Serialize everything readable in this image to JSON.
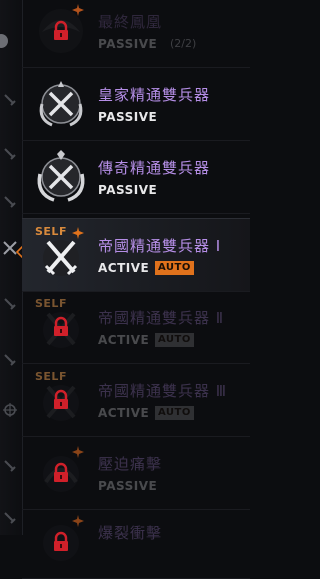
{
  "skills": [
    {
      "title": "最終鳳凰",
      "type": "PASSIVE",
      "locked": true,
      "emblem": "lock-icon"
    },
    {
      "title": "皇家精通雙兵器",
      "type": "PASSIVE",
      "locked": false,
      "emblem": "crossed-blades-emblem"
    },
    {
      "title": "傳奇精通雙兵器",
      "type": "PASSIVE",
      "locked": false,
      "emblem": "crossed-blades-emblem"
    },
    {
      "title": "帝國精通雙兵器 Ⅰ",
      "type": "ACTIVE",
      "auto": "AUTO",
      "self": "SELF",
      "selected": true,
      "emblem": "crossed-swords-emblem"
    },
    {
      "title": "帝國精通雙兵器 Ⅱ",
      "type": "ACTIVE",
      "auto": "AUTO",
      "self": "SELF",
      "locked": true,
      "emblem": "lock-icon"
    },
    {
      "title": "帝國精通雙兵器 Ⅲ",
      "type": "ACTIVE",
      "auto": "AUTO",
      "self": "SELF",
      "locked": true,
      "emblem": "lock-icon"
    },
    {
      "title": "壓迫痛擊",
      "type": "PASSIVE",
      "locked": true,
      "emblem": "lock-icon"
    },
    {
      "title": "爆裂衝擊",
      "type": "",
      "locked": true,
      "emblem": "lock-icon"
    }
  ],
  "faint_suffix": "(2/2)",
  "colors": {
    "accent": "#e0721c",
    "title_purple": "#b58ee6",
    "lock_red": "#d0202a",
    "self_orange": "#d98a3c"
  }
}
